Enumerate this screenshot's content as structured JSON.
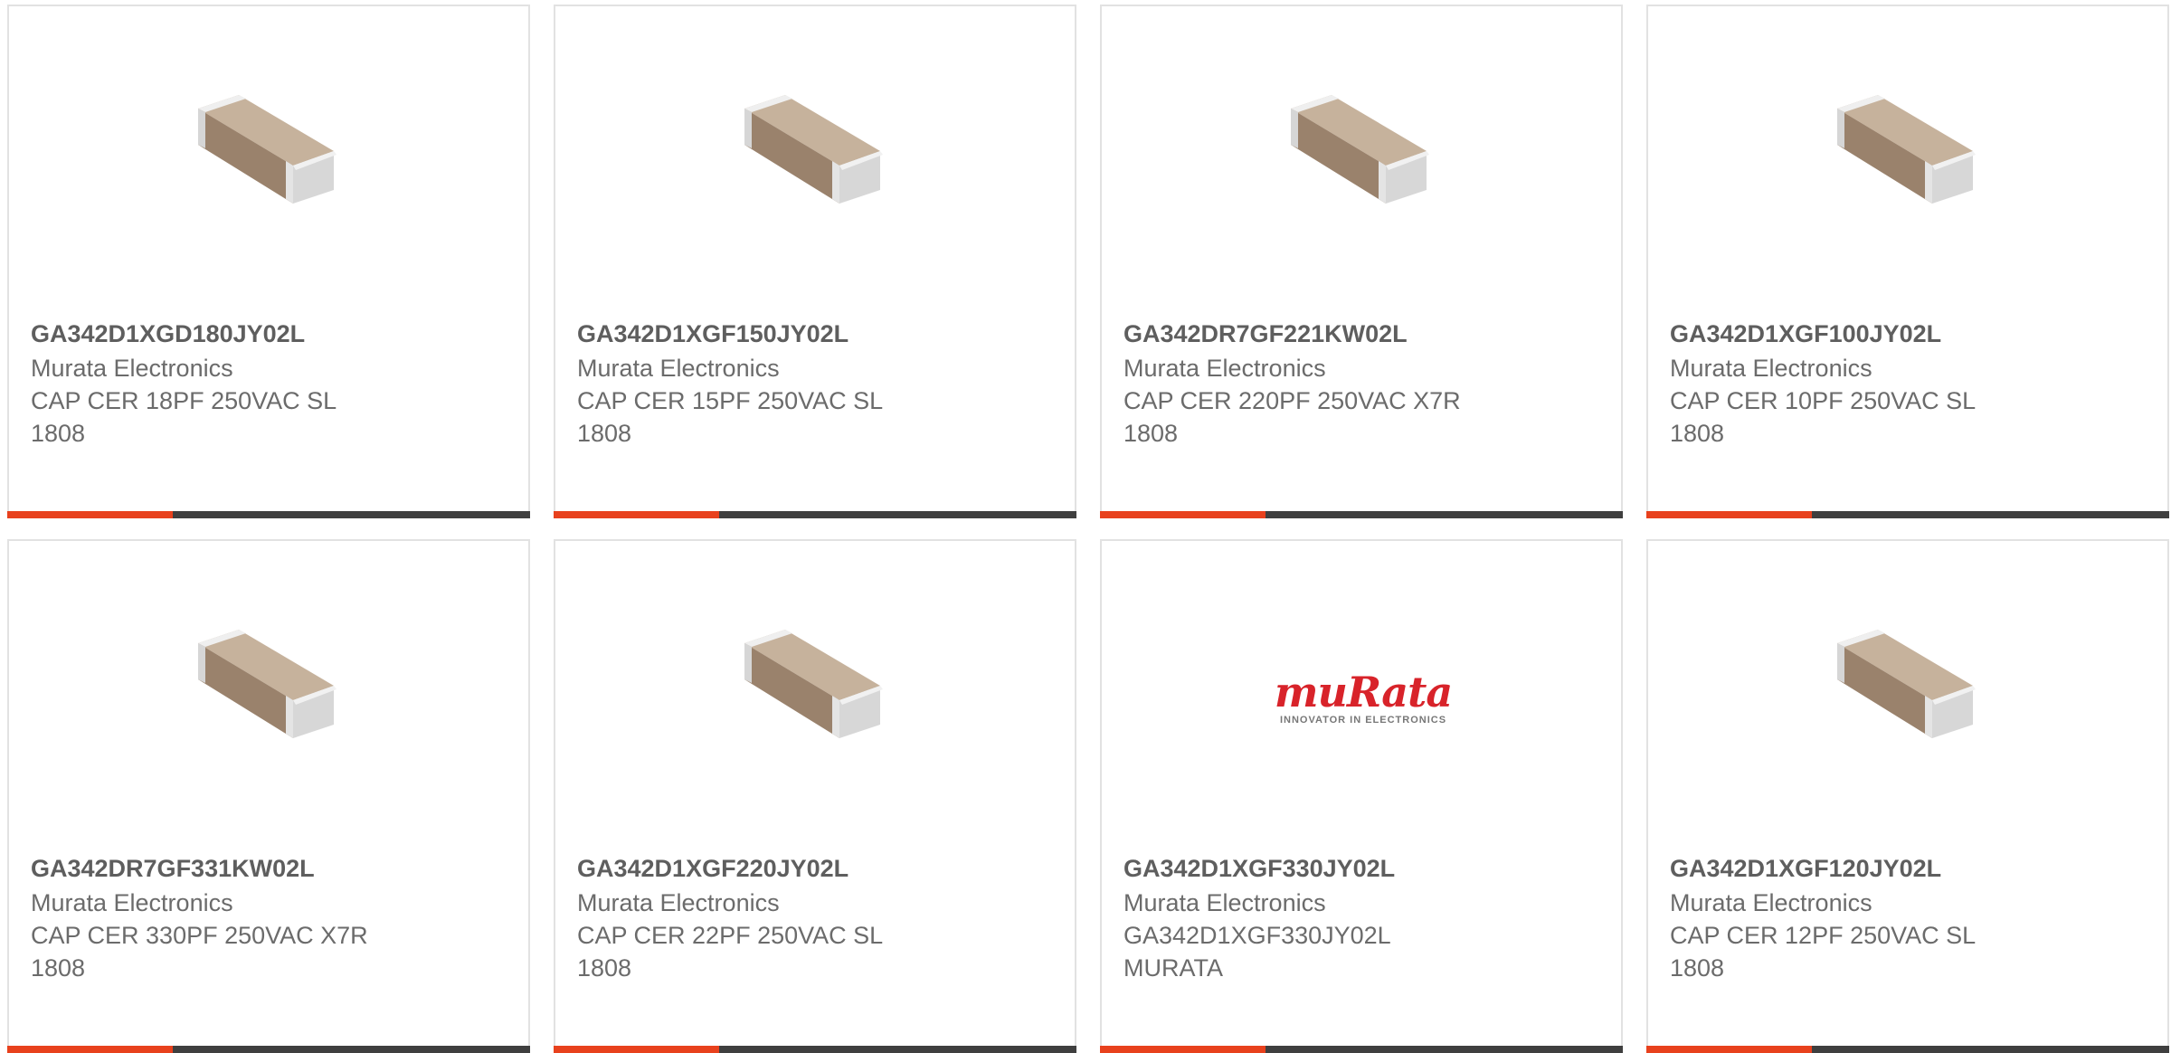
{
  "colors": {
    "accent": "#e8411d",
    "bar": "#3f3f3f",
    "border": "#e2e2e2",
    "text": "#6b6b6b"
  },
  "products": [
    {
      "part_number": "GA342D1XGD180JY02L",
      "manufacturer": "Murata Electronics",
      "description_line1": "CAP CER 18PF 250VAC SL",
      "description_line2": "1808",
      "image": "mlcc-chip-capacitor"
    },
    {
      "part_number": "GA342D1XGF150JY02L",
      "manufacturer": "Murata Electronics",
      "description_line1": "CAP CER 15PF 250VAC SL",
      "description_line2": "1808",
      "image": "mlcc-chip-capacitor"
    },
    {
      "part_number": "GA342DR7GF221KW02L",
      "manufacturer": "Murata Electronics",
      "description_line1": "CAP CER 220PF 250VAC X7R",
      "description_line2": "1808",
      "image": "mlcc-chip-capacitor"
    },
    {
      "part_number": "GA342D1XGF100JY02L",
      "manufacturer": "Murata Electronics",
      "description_line1": "CAP CER 10PF 250VAC SL",
      "description_line2": "1808",
      "image": "mlcc-chip-capacitor"
    },
    {
      "part_number": "GA342DR7GF331KW02L",
      "manufacturer": "Murata Electronics",
      "description_line1": "CAP CER 330PF 250VAC X7R",
      "description_line2": "1808",
      "image": "mlcc-chip-capacitor"
    },
    {
      "part_number": "GA342D1XGF220JY02L",
      "manufacturer": "Murata Electronics",
      "description_line1": "CAP CER 22PF 250VAC SL",
      "description_line2": "1808",
      "image": "mlcc-chip-capacitor"
    },
    {
      "part_number": "GA342D1XGF330JY02L",
      "manufacturer": "Murata Electronics",
      "description_line1": "GA342D1XGF330JY02L",
      "description_line2": "MURATA",
      "image": "murata-logo",
      "logo": {
        "wordmark": "muRata",
        "tagline": "INNOVATOR IN ELECTRONICS"
      }
    },
    {
      "part_number": "GA342D1XGF120JY02L",
      "manufacturer": "Murata Electronics",
      "description_line1": "CAP CER 12PF 250VAC SL",
      "description_line2": "1808",
      "image": "mlcc-chip-capacitor"
    }
  ]
}
